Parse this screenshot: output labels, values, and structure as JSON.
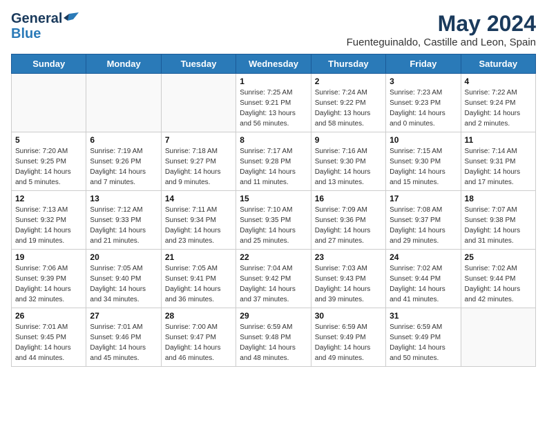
{
  "header": {
    "logo_general": "General",
    "logo_blue": "Blue",
    "month_title": "May 2024",
    "location": "Fuenteguinaldo, Castille and Leon, Spain"
  },
  "weekdays": [
    "Sunday",
    "Monday",
    "Tuesday",
    "Wednesday",
    "Thursday",
    "Friday",
    "Saturday"
  ],
  "weeks": [
    [
      {
        "day": "",
        "info": "",
        "empty": true
      },
      {
        "day": "",
        "info": "",
        "empty": true
      },
      {
        "day": "",
        "info": "",
        "empty": true
      },
      {
        "day": "1",
        "info": "Sunrise: 7:25 AM\nSunset: 9:21 PM\nDaylight: 13 hours\nand 56 minutes.",
        "empty": false
      },
      {
        "day": "2",
        "info": "Sunrise: 7:24 AM\nSunset: 9:22 PM\nDaylight: 13 hours\nand 58 minutes.",
        "empty": false
      },
      {
        "day": "3",
        "info": "Sunrise: 7:23 AM\nSunset: 9:23 PM\nDaylight: 14 hours\nand 0 minutes.",
        "empty": false
      },
      {
        "day": "4",
        "info": "Sunrise: 7:22 AM\nSunset: 9:24 PM\nDaylight: 14 hours\nand 2 minutes.",
        "empty": false
      }
    ],
    [
      {
        "day": "5",
        "info": "Sunrise: 7:20 AM\nSunset: 9:25 PM\nDaylight: 14 hours\nand 5 minutes.",
        "empty": false
      },
      {
        "day": "6",
        "info": "Sunrise: 7:19 AM\nSunset: 9:26 PM\nDaylight: 14 hours\nand 7 minutes.",
        "empty": false
      },
      {
        "day": "7",
        "info": "Sunrise: 7:18 AM\nSunset: 9:27 PM\nDaylight: 14 hours\nand 9 minutes.",
        "empty": false
      },
      {
        "day": "8",
        "info": "Sunrise: 7:17 AM\nSunset: 9:28 PM\nDaylight: 14 hours\nand 11 minutes.",
        "empty": false
      },
      {
        "day": "9",
        "info": "Sunrise: 7:16 AM\nSunset: 9:30 PM\nDaylight: 14 hours\nand 13 minutes.",
        "empty": false
      },
      {
        "day": "10",
        "info": "Sunrise: 7:15 AM\nSunset: 9:30 PM\nDaylight: 14 hours\nand 15 minutes.",
        "empty": false
      },
      {
        "day": "11",
        "info": "Sunrise: 7:14 AM\nSunset: 9:31 PM\nDaylight: 14 hours\nand 17 minutes.",
        "empty": false
      }
    ],
    [
      {
        "day": "12",
        "info": "Sunrise: 7:13 AM\nSunset: 9:32 PM\nDaylight: 14 hours\nand 19 minutes.",
        "empty": false
      },
      {
        "day": "13",
        "info": "Sunrise: 7:12 AM\nSunset: 9:33 PM\nDaylight: 14 hours\nand 21 minutes.",
        "empty": false
      },
      {
        "day": "14",
        "info": "Sunrise: 7:11 AM\nSunset: 9:34 PM\nDaylight: 14 hours\nand 23 minutes.",
        "empty": false
      },
      {
        "day": "15",
        "info": "Sunrise: 7:10 AM\nSunset: 9:35 PM\nDaylight: 14 hours\nand 25 minutes.",
        "empty": false
      },
      {
        "day": "16",
        "info": "Sunrise: 7:09 AM\nSunset: 9:36 PM\nDaylight: 14 hours\nand 27 minutes.",
        "empty": false
      },
      {
        "day": "17",
        "info": "Sunrise: 7:08 AM\nSunset: 9:37 PM\nDaylight: 14 hours\nand 29 minutes.",
        "empty": false
      },
      {
        "day": "18",
        "info": "Sunrise: 7:07 AM\nSunset: 9:38 PM\nDaylight: 14 hours\nand 31 minutes.",
        "empty": false
      }
    ],
    [
      {
        "day": "19",
        "info": "Sunrise: 7:06 AM\nSunset: 9:39 PM\nDaylight: 14 hours\nand 32 minutes.",
        "empty": false
      },
      {
        "day": "20",
        "info": "Sunrise: 7:05 AM\nSunset: 9:40 PM\nDaylight: 14 hours\nand 34 minutes.",
        "empty": false
      },
      {
        "day": "21",
        "info": "Sunrise: 7:05 AM\nSunset: 9:41 PM\nDaylight: 14 hours\nand 36 minutes.",
        "empty": false
      },
      {
        "day": "22",
        "info": "Sunrise: 7:04 AM\nSunset: 9:42 PM\nDaylight: 14 hours\nand 37 minutes.",
        "empty": false
      },
      {
        "day": "23",
        "info": "Sunrise: 7:03 AM\nSunset: 9:43 PM\nDaylight: 14 hours\nand 39 minutes.",
        "empty": false
      },
      {
        "day": "24",
        "info": "Sunrise: 7:02 AM\nSunset: 9:44 PM\nDaylight: 14 hours\nand 41 minutes.",
        "empty": false
      },
      {
        "day": "25",
        "info": "Sunrise: 7:02 AM\nSunset: 9:44 PM\nDaylight: 14 hours\nand 42 minutes.",
        "empty": false
      }
    ],
    [
      {
        "day": "26",
        "info": "Sunrise: 7:01 AM\nSunset: 9:45 PM\nDaylight: 14 hours\nand 44 minutes.",
        "empty": false
      },
      {
        "day": "27",
        "info": "Sunrise: 7:01 AM\nSunset: 9:46 PM\nDaylight: 14 hours\nand 45 minutes.",
        "empty": false
      },
      {
        "day": "28",
        "info": "Sunrise: 7:00 AM\nSunset: 9:47 PM\nDaylight: 14 hours\nand 46 minutes.",
        "empty": false
      },
      {
        "day": "29",
        "info": "Sunrise: 6:59 AM\nSunset: 9:48 PM\nDaylight: 14 hours\nand 48 minutes.",
        "empty": false
      },
      {
        "day": "30",
        "info": "Sunrise: 6:59 AM\nSunset: 9:49 PM\nDaylight: 14 hours\nand 49 minutes.",
        "empty": false
      },
      {
        "day": "31",
        "info": "Sunrise: 6:59 AM\nSunset: 9:49 PM\nDaylight: 14 hours\nand 50 minutes.",
        "empty": false
      },
      {
        "day": "",
        "info": "",
        "empty": true
      }
    ]
  ]
}
